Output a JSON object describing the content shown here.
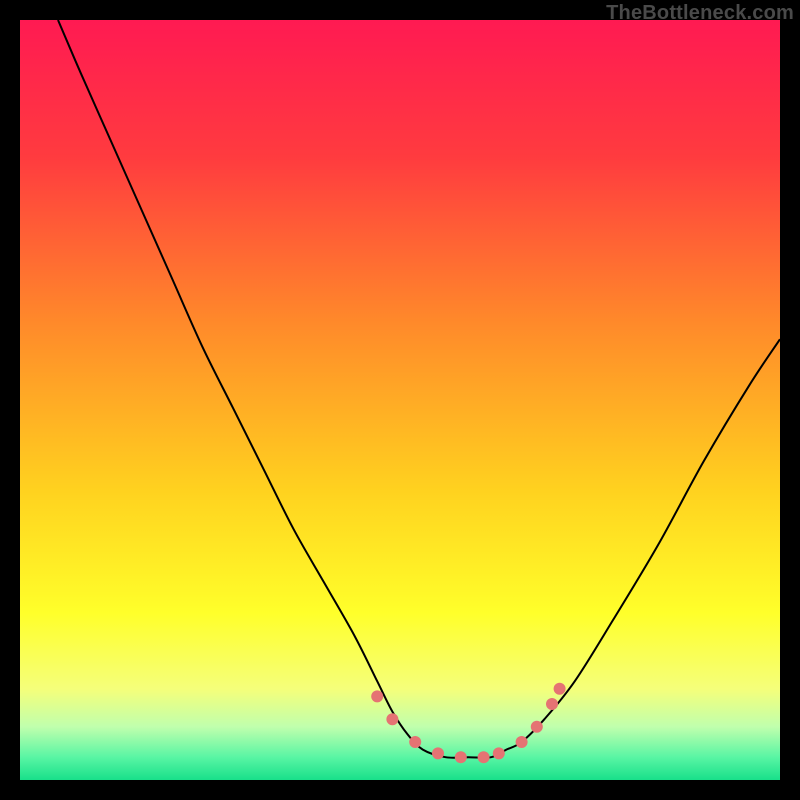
{
  "attribution": "TheBottleneck.com",
  "chart_data": {
    "type": "line",
    "title": "",
    "xlabel": "",
    "ylabel": "",
    "xlim": [
      0,
      100
    ],
    "ylim": [
      0,
      100
    ],
    "background_gradient": {
      "stops": [
        {
          "offset": 0,
          "color": "#ff1a52"
        },
        {
          "offset": 0.18,
          "color": "#ff3b3f"
        },
        {
          "offset": 0.4,
          "color": "#ff8a2a"
        },
        {
          "offset": 0.62,
          "color": "#ffd21f"
        },
        {
          "offset": 0.78,
          "color": "#ffff2a"
        },
        {
          "offset": 0.88,
          "color": "#f5ff7a"
        },
        {
          "offset": 0.93,
          "color": "#c0ffad"
        },
        {
          "offset": 0.97,
          "color": "#59f5a4"
        },
        {
          "offset": 1.0,
          "color": "#18e08a"
        }
      ]
    },
    "series": [
      {
        "name": "bottleneck-curve",
        "color": "#000000",
        "width": 2,
        "x": [
          5,
          8,
          12,
          16,
          20,
          24,
          28,
          32,
          36,
          40,
          44,
          47,
          49,
          51,
          53,
          56,
          59,
          62,
          64,
          66,
          69,
          73,
          78,
          84,
          90,
          96,
          100
        ],
        "y": [
          100,
          93,
          84,
          75,
          66,
          57,
          49,
          41,
          33,
          26,
          19,
          13,
          9,
          6,
          4,
          3,
          3,
          3,
          4,
          5,
          8,
          13,
          21,
          31,
          42,
          52,
          58
        ]
      }
    ],
    "markers": {
      "name": "highlight-points",
      "color": "#e57373",
      "radius": 6,
      "points": [
        {
          "x": 47,
          "y": 11
        },
        {
          "x": 49,
          "y": 8
        },
        {
          "x": 52,
          "y": 5
        },
        {
          "x": 55,
          "y": 3.5
        },
        {
          "x": 58,
          "y": 3
        },
        {
          "x": 61,
          "y": 3
        },
        {
          "x": 63,
          "y": 3.5
        },
        {
          "x": 66,
          "y": 5
        },
        {
          "x": 68,
          "y": 7
        },
        {
          "x": 70,
          "y": 10
        },
        {
          "x": 71,
          "y": 12
        }
      ]
    }
  }
}
